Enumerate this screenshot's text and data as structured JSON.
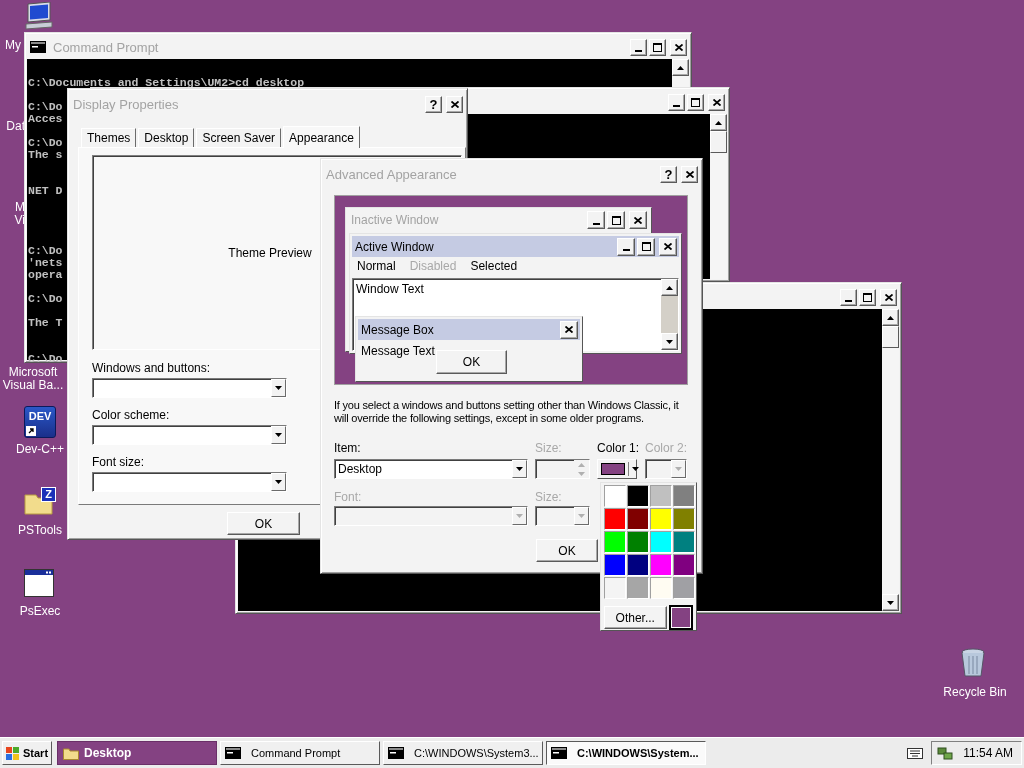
{
  "desktop": {
    "icons": [
      {
        "kind": "computer",
        "lines": [
          "My"
        ]
      },
      {
        "kind": "hidden",
        "lines": [
          "Dat"
        ]
      },
      {
        "kind": "hidden",
        "lines": [
          "M",
          "Vi"
        ]
      },
      {
        "kind": "hidden",
        "lines": [
          "Microsoft",
          "Visual Ba..."
        ]
      },
      {
        "kind": "dev",
        "badge": "DEV",
        "lines": [
          "Dev-C++"
        ]
      },
      {
        "kind": "folder",
        "badge": "Z",
        "lines": [
          "PSTools"
        ]
      },
      {
        "kind": "app",
        "lines": [
          "PsExec"
        ]
      },
      {
        "kind": "recycle",
        "lines": [
          "Recycle Bin"
        ]
      }
    ]
  },
  "command_prompt": {
    "title": "Command Prompt",
    "active": false,
    "blocks": [
      [
        "C:\\Documents and Settings\\UM2>cd desktop"
      ],
      [
        "C:\\Do",
        "Acces"
      ],
      [
        "C:\\Do",
        "The s"
      ],
      [
        "NET D"
      ],
      [
        "C:\\Do",
        "'nets",
        "opera"
      ],
      [
        "C:\\Do"
      ],
      [
        "The T"
      ],
      [
        "C:\\Do"
      ]
    ]
  },
  "console_2": {
    "active": false
  },
  "console_3": {
    "active": false
  },
  "display_properties": {
    "title": "Display Properties",
    "active": false,
    "help_button": "?",
    "tabs": [
      {
        "label": "Themes",
        "selected": false
      },
      {
        "label": "Desktop",
        "selected": false
      },
      {
        "label": "Screen Saver",
        "selected": false
      },
      {
        "label": "Appearance",
        "selected": true
      }
    ],
    "preview": "Theme Preview",
    "fields": [
      {
        "label": "Windows and buttons:"
      },
      {
        "label": "Color scheme:"
      },
      {
        "label": "Font size:"
      }
    ],
    "buttons": [
      "OK"
    ]
  },
  "advanced_appearance": {
    "title": "Advanced Appearance",
    "active": false,
    "help_button": "?",
    "preview": {
      "inactive_title": "Inactive Window",
      "active_title": "Active Window",
      "menu": [
        {
          "label": "Normal",
          "disabled": false
        },
        {
          "label": "Disabled",
          "disabled": true
        },
        {
          "label": "Selected",
          "disabled": false
        }
      ],
      "window_text": "Window Text",
      "message_title": "Message Box",
      "message_text": "Message Text",
      "message_button": "OK"
    },
    "note": "If you select a windows and buttons setting other than Windows Classic, it will override the following settings, except in some older programs.",
    "item": {
      "label": "Item:",
      "value": "Desktop",
      "disabled": false
    },
    "item_size": {
      "label": "Size:",
      "disabled": true
    },
    "color_1": {
      "label": "Color 1:",
      "color": "#844282",
      "disabled": false
    },
    "color_2": {
      "label": "Color 2:",
      "disabled": true
    },
    "font": {
      "label": "Font:",
      "disabled": true
    },
    "font_size": {
      "label": "Size:",
      "disabled": true
    },
    "buttons": [
      "OK"
    ]
  },
  "color_palette": {
    "swatches": [
      {
        "color": "#ffffff"
      },
      {
        "color": "#000000"
      },
      {
        "color": "#c0c0c0"
      },
      {
        "color": "#808080"
      },
      {
        "color": "#ff0000"
      },
      {
        "color": "#800000"
      },
      {
        "color": "#ffff00"
      },
      {
        "color": "#808000"
      },
      {
        "color": "#00ff00"
      },
      {
        "color": "#008000"
      },
      {
        "color": "#00ffff"
      },
      {
        "color": "#008080"
      },
      {
        "color": "#0000ff"
      },
      {
        "color": "#000080"
      },
      {
        "color": "#ff00ff"
      },
      {
        "color": "#800080"
      },
      {
        "color": "#f4f4f4"
      },
      {
        "color": "#a6a6a6"
      },
      {
        "color": "#fffcf2"
      },
      {
        "color": "#a0a0a4"
      }
    ],
    "other_button": "Other...",
    "custom": {
      "color": "#844282"
    }
  },
  "taskbar": {
    "start_button": "Start",
    "toolbar": {
      "label": "Desktop"
    },
    "buttons": [
      {
        "label": "Command Prompt",
        "selected": false
      },
      {
        "label": "C:\\WINDOWS\\System3...",
        "selected": false
      },
      {
        "label": "C:\\WINDOWS\\System...",
        "selected": true
      }
    ],
    "clock": "11:54 AM"
  }
}
